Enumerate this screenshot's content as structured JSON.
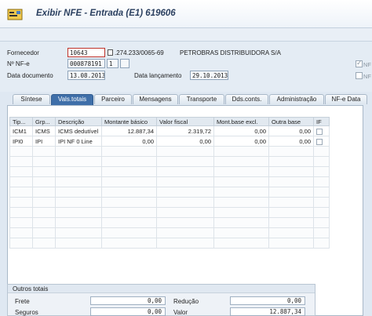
{
  "window": {
    "title": "Exibir NFE - Entrada (E1) 619606"
  },
  "header": {
    "fornecedor_label": "Fornecedor",
    "fornecedor_value": "10643",
    "cnpj_value": ".274.233/0065-69",
    "supplier_name": "PETROBRAS DISTRIBUIDORA S/A",
    "nfe_label": "Nº NF-e",
    "nfe_value": "000878191",
    "serie_value": "1",
    "data_doc_label": "Data documento",
    "data_doc_value": "13.08.2013",
    "data_lanc_label": "Data lançamento",
    "data_lanc_value": "29.10.2013",
    "check1_label": "NF",
    "check2_label": "NF"
  },
  "tabs": [
    {
      "label": "Síntese"
    },
    {
      "label": "Vals.totais"
    },
    {
      "label": "Parceiro"
    },
    {
      "label": "Mensagens"
    },
    {
      "label": "Transporte"
    },
    {
      "label": "Dds.conts."
    },
    {
      "label": "Administração"
    },
    {
      "label": "NF-e Data"
    }
  ],
  "grid": {
    "columns": [
      "Tip...",
      "Grp...",
      "Descrição",
      "Montante básico",
      "Valor fiscal",
      "Mont.base excl.",
      "Outra base",
      "IF"
    ],
    "rows": [
      [
        "ICM1",
        "ICMS",
        "ICMS dedutível",
        "12.887,34",
        "2.319,72",
        "0,00",
        "0,00"
      ],
      [
        "IPI0",
        "IPI",
        "IPI NF 0 Line",
        "0,00",
        "0,00",
        "0,00",
        "0,00"
      ]
    ]
  },
  "totals": {
    "title": "Outros totais",
    "frete_label": "Frete",
    "frete_value": "0,00",
    "reducao_label": "Redução",
    "reducao_value": "0,00",
    "seguros_label": "Seguros",
    "seguros_value": "0,00",
    "valor_label": "Valor",
    "valor_value": "12.887,34"
  },
  "colors": {
    "active_tab": "#3f6fa9",
    "background": "#dfe8f2"
  }
}
